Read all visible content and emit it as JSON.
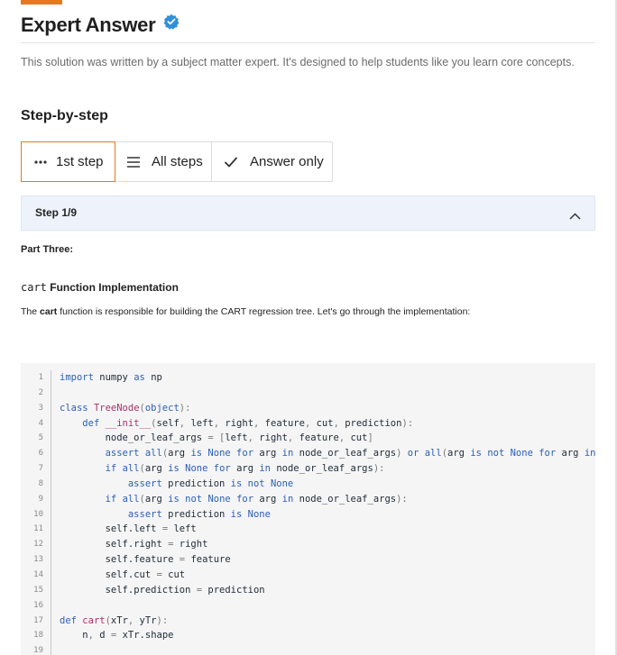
{
  "header": {
    "title": "Expert Answer",
    "verified_icon": "verified-badge-icon",
    "accent_color": "#e87722",
    "description": "This solution was written by a subject matter expert. It's designed to help students like you learn core concepts."
  },
  "section_title": "Step-by-step",
  "tabs": [
    {
      "label": "1st step",
      "icon": "dots-icon",
      "active": true
    },
    {
      "label": "All steps",
      "icon": "list-icon",
      "active": false
    },
    {
      "label": "Answer only",
      "icon": "check-icon",
      "active": false
    }
  ],
  "step": {
    "label": "Step 1/9",
    "part": "Part Three:",
    "heading_code": "cart",
    "heading_text": "Function Implementation",
    "intro_before": "The ",
    "intro_code": "cart",
    "intro_after": " function is responsible for building the CART regression tree. Let's go through the implementation:"
  },
  "code": {
    "line_numbers": [
      "1",
      "2",
      "3",
      "4",
      "5",
      "6",
      "7",
      "8",
      "9",
      "10",
      "11",
      "12",
      "13",
      "14",
      "15",
      "16",
      "17",
      "18",
      "19"
    ],
    "lines": [
      "import numpy as np",
      "",
      "class TreeNode(object):",
      "    def __init__(self, left, right, feature, cut, prediction):",
      "        node_or_leaf_args = [left, right, feature, cut]",
      "        assert all(arg is None for arg in node_or_leaf_args) or all(arg is not None for arg in",
      "        if all(arg is None for arg in node_or_leaf_args):",
      "            assert prediction is not None",
      "        if all(arg is not None for arg in node_or_leaf_args):",
      "            assert prediction is None",
      "        self.left = left",
      "        self.right = right",
      "        self.feature = feature",
      "        self.cut = cut",
      "        self.prediction = prediction",
      "",
      "def cart(xTr, yTr):",
      "    n, d = xTr.shape",
      ""
    ]
  }
}
